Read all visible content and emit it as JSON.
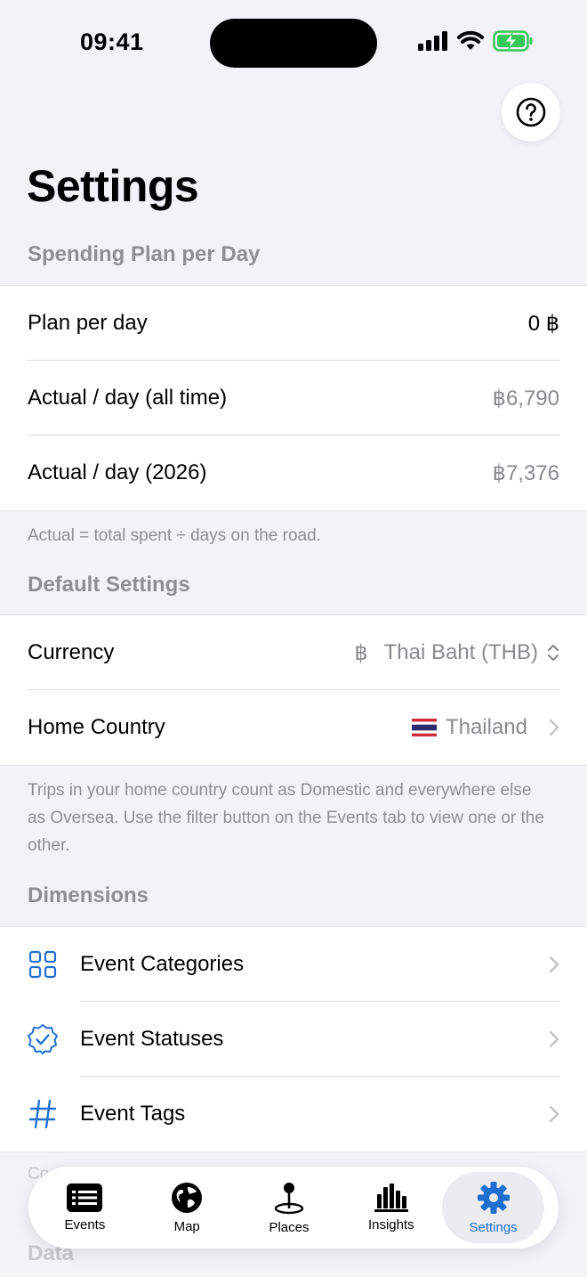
{
  "status_bar": {
    "time": "09:41"
  },
  "page": {
    "title": "Settings"
  },
  "spending_section": {
    "header": "Spending Plan per Day",
    "rows": [
      {
        "label": "Plan per day",
        "value": "0 ฿"
      },
      {
        "label": "Actual / day (all time)",
        "value": "฿6,790"
      },
      {
        "label": "Actual / day (2026)",
        "value": "฿7,376"
      }
    ],
    "footer": "Actual = total spent ÷ days on the road."
  },
  "default_section": {
    "header": "Default Settings",
    "currency": {
      "label": "Currency",
      "symbol": "฿",
      "value": "Thai Baht (THB)"
    },
    "home_country": {
      "label": "Home Country",
      "value": "Thailand"
    },
    "footer": "Trips in your home country count as Domestic and everywhere else as Oversea. Use the filter button on the Events tab to view one or the other."
  },
  "dimensions_section": {
    "header": "Dimensions",
    "rows": [
      {
        "label": "Event Categories",
        "icon": "grid-icon"
      },
      {
        "label": "Event Statuses",
        "icon": "checkmark-seal-icon"
      },
      {
        "label": "Event Tags",
        "icon": "hashtag-icon"
      }
    ]
  },
  "obscured": {
    "footer_partial": "Co",
    "next_header": "Data"
  },
  "tab_bar": {
    "tabs": [
      {
        "label": "Events",
        "icon": "list-icon",
        "selected": false
      },
      {
        "label": "Map",
        "icon": "globe-icon",
        "selected": false
      },
      {
        "label": "Places",
        "icon": "map-pin-icon",
        "selected": false
      },
      {
        "label": "Insights",
        "icon": "bar-chart-icon",
        "selected": false
      },
      {
        "label": "Settings",
        "icon": "gear-icon",
        "selected": true
      }
    ]
  },
  "colors": {
    "accent": "#1f6fd1",
    "background": "#f2f2f7",
    "secondary_text": "#8e8e93"
  }
}
